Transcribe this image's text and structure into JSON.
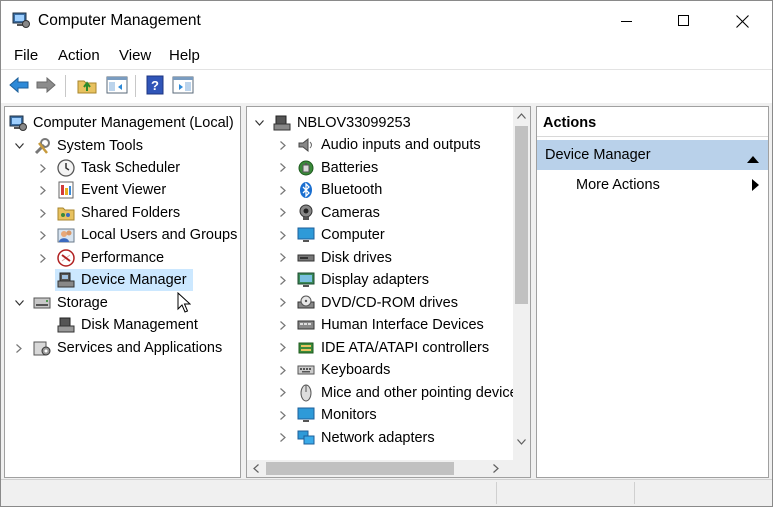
{
  "window": {
    "title": "Computer Management",
    "controls": [
      "minimize",
      "maximize",
      "close"
    ]
  },
  "menu": [
    "File",
    "Action",
    "View",
    "Help"
  ],
  "toolbar": {
    "buttons": [
      "back-icon",
      "forward-icon",
      "up-folder-icon",
      "show-hide-console-tree-icon",
      "help-icon",
      "show-hide-action-pane-icon"
    ]
  },
  "left_tree": {
    "root": "Computer Management (Local)",
    "system_tools": "System Tools",
    "items": [
      "Task Scheduler",
      "Event Viewer",
      "Shared Folders",
      "Local Users and Groups",
      "Performance",
      "Device Manager"
    ],
    "selected": "Device Manager",
    "storage": "Storage",
    "disk_management": "Disk Management",
    "services": "Services and Applications"
  },
  "device_tree": {
    "computer": "NBLOV33099253",
    "categories": [
      "Audio inputs and outputs",
      "Batteries",
      "Bluetooth",
      "Cameras",
      "Computer",
      "Disk drives",
      "Display adapters",
      "DVD/CD-ROM drives",
      "Human Interface Devices",
      "IDE ATA/ATAPI controllers",
      "Keyboards",
      "Mice and other pointing devices",
      "Monitors",
      "Network adapters"
    ]
  },
  "actions": {
    "header": "Actions",
    "section": "Device Manager",
    "more": "More Actions"
  },
  "colors": {
    "selection": "#cce8ff",
    "action_section": "#b9d1ea"
  }
}
